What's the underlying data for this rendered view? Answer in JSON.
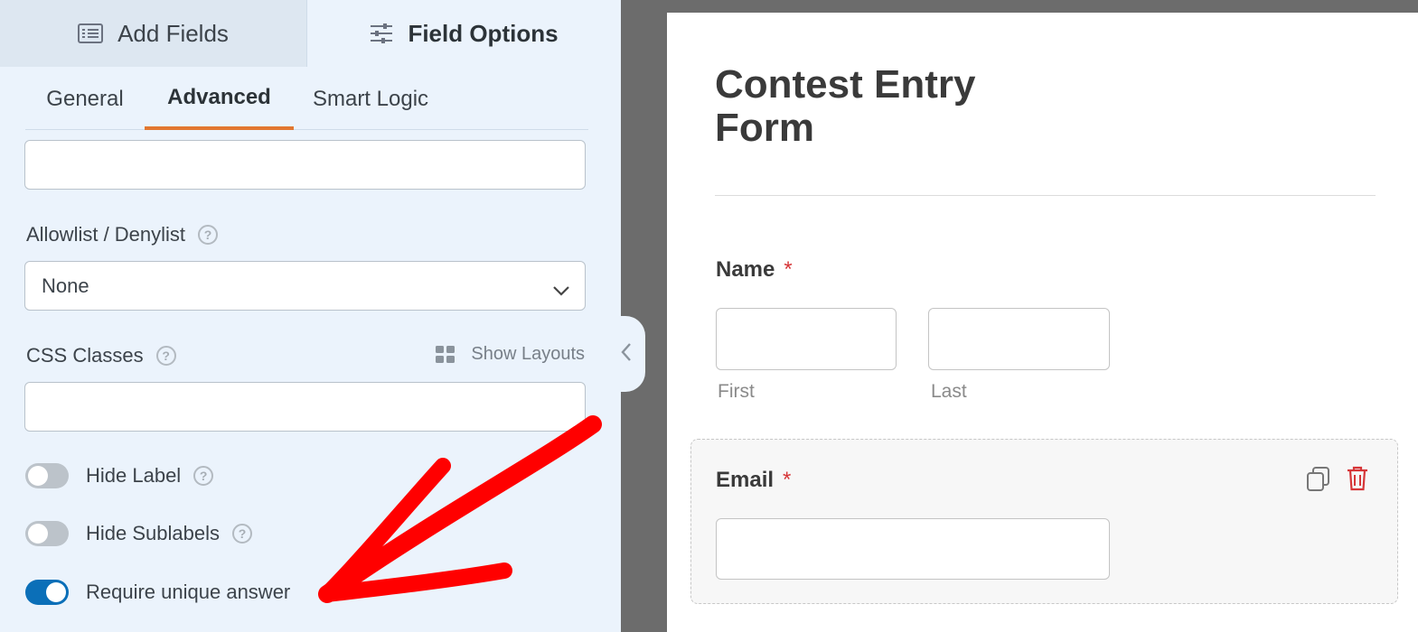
{
  "builder": {
    "top_tabs": {
      "add_fields": "Add Fields",
      "field_options": "Field Options"
    },
    "sub_tabs": {
      "general": "General",
      "advanced": "Advanced",
      "smart_logic": "Smart Logic"
    },
    "advanced": {
      "allowlist_label": "Allowlist / Denylist",
      "allowlist_value": "None",
      "css_classes_label": "CSS Classes",
      "show_layouts": "Show Layouts",
      "toggles": [
        {
          "label": "Hide Label",
          "on": false
        },
        {
          "label": "Hide Sublabels",
          "on": false
        },
        {
          "label": "Require unique answer",
          "on": true
        }
      ]
    }
  },
  "form": {
    "title": "Contest Entry Form",
    "name_label": "Name",
    "required_marker": "*",
    "first_sublabel": "First",
    "last_sublabel": "Last",
    "email_label": "Email"
  },
  "colors": {
    "accent_tab": "#e27730",
    "toggle_on": "#0b6fb8",
    "required": "#d63638",
    "annotation_arrow": "#ff0000"
  },
  "icons": {
    "add_fields": "list-icon",
    "field_options": "sliders-icon",
    "help": "question-circle-icon",
    "layouts": "grid-icon",
    "select_chevron": "chevron-down-icon",
    "collapse": "chevron-left-icon",
    "duplicate": "duplicate-icon",
    "delete": "trash-icon"
  }
}
